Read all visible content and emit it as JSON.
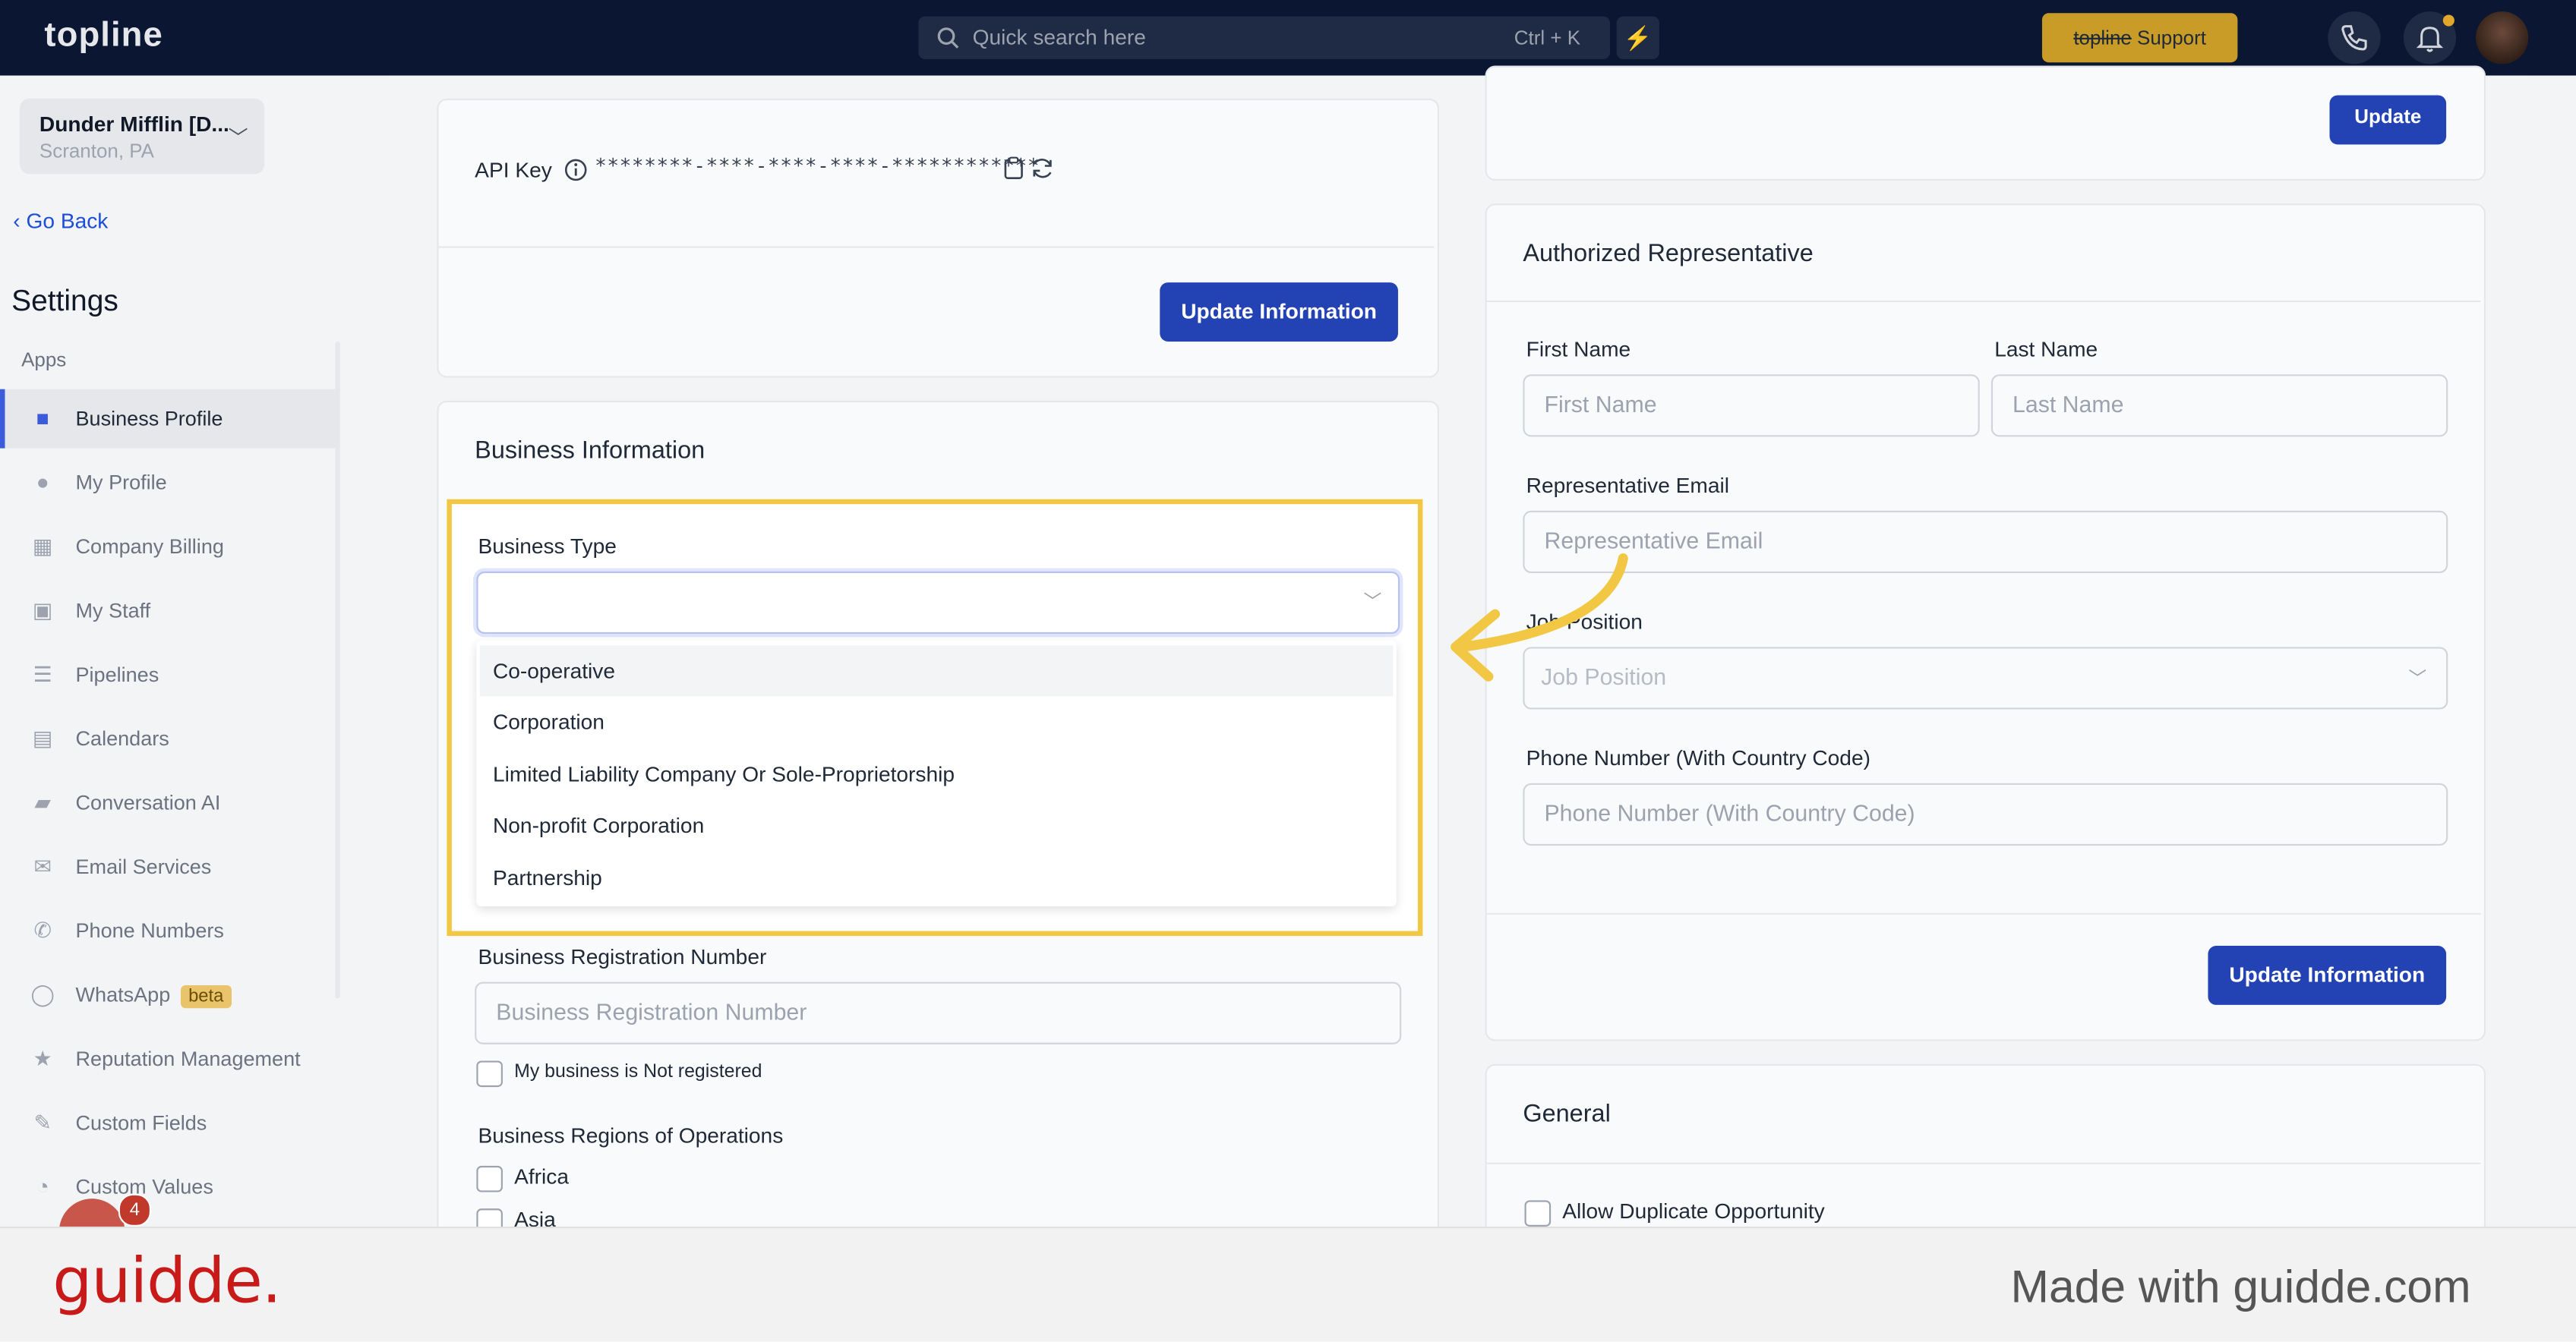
{
  "topbar": {
    "logo": "topline",
    "search_placeholder": "Quick search here",
    "search_shortcut": "Ctrl + K",
    "support_brand": "topline",
    "support_label": " Support",
    "accent_color": "#c89c27"
  },
  "sidebar": {
    "location_name": "Dunder Mifflin [D...",
    "location_address": "Scranton, PA",
    "go_back": "Go Back",
    "title": "Settings",
    "section": "Apps",
    "items": [
      {
        "label": "Business Profile",
        "icon": "briefcase-icon",
        "active": true
      },
      {
        "label": "My Profile",
        "icon": "user-icon"
      },
      {
        "label": "Company Billing",
        "icon": "billing-icon"
      },
      {
        "label": "My Staff",
        "icon": "staff-icon"
      },
      {
        "label": "Pipelines",
        "icon": "pipeline-icon"
      },
      {
        "label": "Calendars",
        "icon": "calendar-icon"
      },
      {
        "label": "Conversation AI",
        "icon": "chat-icon"
      },
      {
        "label": "Email Services",
        "icon": "email-icon"
      },
      {
        "label": "Phone Numbers",
        "icon": "phone-icon"
      },
      {
        "label": "WhatsApp",
        "icon": "whatsapp-icon",
        "badge": "beta"
      },
      {
        "label": "Reputation Management",
        "icon": "star-icon"
      },
      {
        "label": "Custom Fields",
        "icon": "edit-icon"
      },
      {
        "label": "Custom Values",
        "icon": "pie-icon"
      }
    ],
    "chat_count": "4"
  },
  "api_card": {
    "api_label": "API Key",
    "api_value": "********-****-****-****-************",
    "update_label": "Update Information"
  },
  "business_info": {
    "title": "Business Information",
    "business_type_label": "Business Type",
    "options": [
      "Co-operative",
      "Corporation",
      "Limited Liability Company Or Sole-Proprietorship",
      "Non-profit Corporation",
      "Partnership"
    ],
    "reg_number_label": "Business Registration Number",
    "reg_number_placeholder": "Business Registration Number",
    "not_registered_label": "My business is Not registered",
    "regions_label": "Business Regions of Operations",
    "regions": [
      "Africa",
      "Asia"
    ]
  },
  "authorized_rep": {
    "title": "Authorized Representative",
    "first_name_label": "First Name",
    "first_name_placeholder": "First Name",
    "last_name_label": "Last Name",
    "last_name_placeholder": "Last Name",
    "email_label": "Representative Email",
    "email_placeholder": "Representative Email",
    "job_label": "Job Position",
    "job_placeholder": "Job Position",
    "phone_label": "Phone Number (With Country Code)",
    "phone_placeholder": "Phone Number (With Country Code)",
    "update_label": "Update Information",
    "top_button_label": "Update"
  },
  "general": {
    "title": "General",
    "allow_duplicate_label": "Allow Duplicate Opportunity"
  },
  "footer": {
    "brand": "guidde.",
    "made_with": "Made with guidde.com",
    "brand_color": "#c91a1a"
  }
}
